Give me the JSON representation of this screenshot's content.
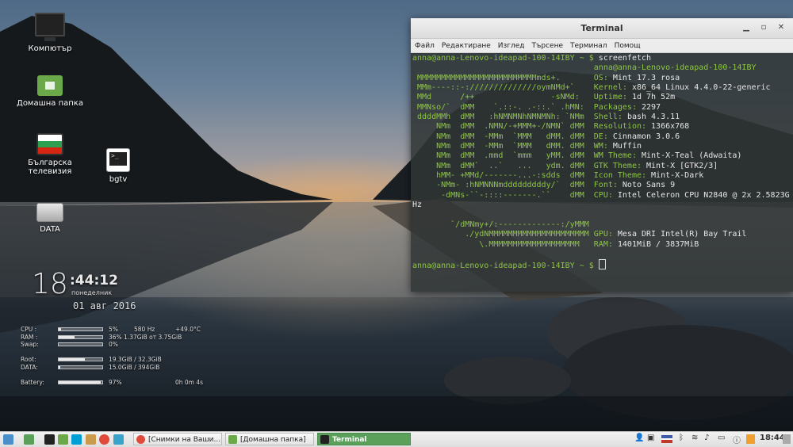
{
  "desktop": {
    "icons": [
      {
        "label": "Компютър",
        "icon": "computer-icon"
      },
      {
        "label": "Домашна папка",
        "icon": "home-folder-icon"
      },
      {
        "label": "Българска телевизия",
        "icon": "tv-icon"
      },
      {
        "label": "bgtv",
        "icon": "terminal-script-icon"
      },
      {
        "label": "DATA",
        "icon": "drive-icon"
      }
    ]
  },
  "conky": {
    "hour": "18",
    "minsec": ":44:12",
    "weekday": "понеделник",
    "date": "01 авг 2016",
    "cpu_label": "CPU :",
    "cpu_pct": "5%",
    "cpu_freq": "580 Hz",
    "cpu_temp": "+49.0°C",
    "cpu_fill": 0.05,
    "ram_label": "RAM :",
    "ram_value": "36% 1.37GiB от 3.75GiB",
    "ram_fill": 0.36,
    "swap_label": "Swap:",
    "swap_value": "0%",
    "swap_fill": 0.0,
    "root_label": "Root:",
    "root_value": "19.3GiB / 32.3GiB",
    "root_fill": 0.6,
    "data_label": "DATA:",
    "data_value": "15.0GiB / 394GiB",
    "data_fill": 0.04,
    "battery_label": "Battery:",
    "battery_value": "97%",
    "battery_time": "0h 0m 4s",
    "battery_fill": 0.97
  },
  "terminal": {
    "title": "Terminal",
    "menu": [
      "Файл",
      "Редактиране",
      "Изглед",
      "Търсене",
      "Терминал",
      "Помощ"
    ],
    "prompt": "anna@anna-Lenovo-ideapad-100-14IBY ~ $",
    "command": "screenfetch",
    "user_host": "anna@anna-Lenovo-ideapad-100-14IBY",
    "logo_lines": [
      "",
      " MMMMMMMMMMMMMMMMMMMMMMMMMmds+.",
      " MMm----::-://////////////oymNMd+`",
      " MMd      /++                -sNMd:",
      " MMNso/`  dMM    `.::-. .-::.` .hMN:",
      " ddddMMh  dMM   :hNMNMNhNMNMNh: `NMm",
      "     NMm  dMM  .NMN/-+MMM+-/NMN` dMM",
      "     NMm  dMM  -MMm  `MMM   dMM. dMM",
      "     NMm  dMM  -MMm  `MMM   dMM. dMM",
      "     NMm  dMM  .mmd  `mmm   yMM. dMM",
      "     NMm  dMM`  ..`   ...   ydm. dMM",
      "     hMM- +MMd/-------...-:sdds  dMM",
      "     -NMm- :hNMNNNmdddddddddy/`  dMM",
      "      -dMNs-``-::::-------.``    dMM",
      "",
      "        `/dMNmy+/:-------------:/yMMM",
      "           ./ydNMMMMMMMMMMMMMMMMMMMMM",
      "              \\.MMMMMMMMMMMMMMMMMMM"
    ],
    "info": [
      {
        "key": "OS:",
        "val": "Mint 17.3 rosa"
      },
      {
        "key": "Kernel:",
        "val": "x86_64 Linux 4.4.0-22-generic"
      },
      {
        "key": "Uptime:",
        "val": "1d 7h 52m"
      },
      {
        "key": "Packages:",
        "val": "2297"
      },
      {
        "key": "Shell:",
        "val": "bash 4.3.11"
      },
      {
        "key": "Resolution:",
        "val": "1366x768"
      },
      {
        "key": "DE:",
        "val": "Cinnamon 3.0.6"
      },
      {
        "key": "WM:",
        "val": "Muffin"
      },
      {
        "key": "WM Theme:",
        "val": "Mint-X-Teal (Adwaita)"
      },
      {
        "key": "GTK Theme:",
        "val": "Mint-X [GTK2/3]"
      },
      {
        "key": "Icon Theme:",
        "val": "Mint-X-Dark"
      },
      {
        "key": "Font:",
        "val": "Noto Sans 9"
      },
      {
        "key": "CPU:",
        "val": "Intel Celeron CPU N2840 @ 2x 2.5823G"
      }
    ],
    "cpu_wrap": "Hz",
    "info2": [
      {
        "key": "GPU:",
        "val": "Mesa DRI Intel(R) Bay Trail"
      },
      {
        "key": "RAM:",
        "val": "1401MiB / 3837MiB"
      }
    ]
  },
  "panel": {
    "tasks": [
      {
        "label": "[Снимки на Ваши...",
        "icon": "chrome-icon"
      },
      {
        "label": "[Домашна папка]",
        "icon": "folder-icon"
      },
      {
        "label": "Terminal",
        "icon": "terminal-icon"
      }
    ],
    "clock": "18:44",
    "colors": {
      "accent": "#5aa05a",
      "mint_green": "#8cc63f"
    }
  }
}
